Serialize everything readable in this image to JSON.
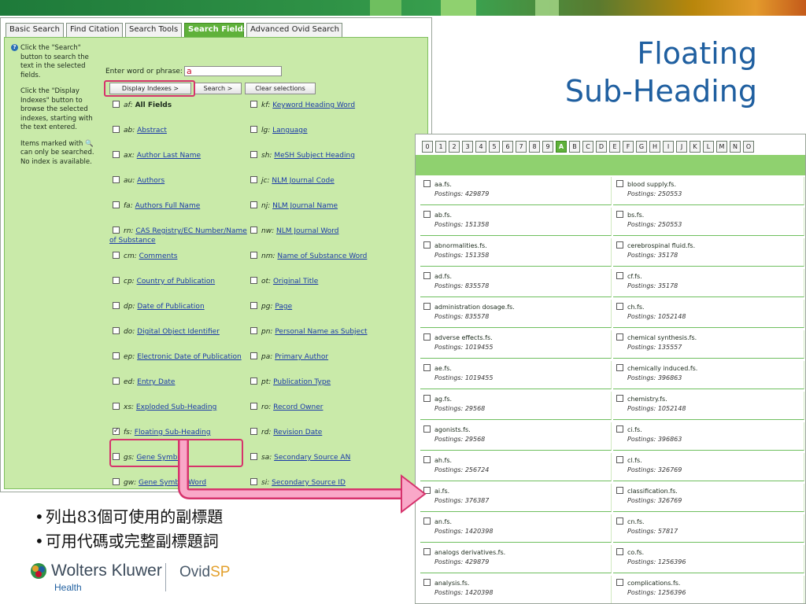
{
  "slide": {
    "title_line1": "Floating",
    "title_line2": "Sub-Heading",
    "bullets": [
      "列出83個可使用的副標題",
      "可用代碼或完整副標題詞"
    ],
    "title_color": "#1f5fa0",
    "accent_pink": "#d6336c"
  },
  "search_panel": {
    "tabs": [
      {
        "label": "Basic Search",
        "active": false
      },
      {
        "label": "Find Citation",
        "active": false
      },
      {
        "label": "Search Tools",
        "active": false
      },
      {
        "label": "Search Fields",
        "active": true
      },
      {
        "label": "Advanced Ovid Search",
        "active": false
      }
    ],
    "instructions": [
      "Click the \"Search\" button to search the text in the selected fields.",
      "Click the \"Display Indexes\" button to browse the selected indexes, starting with the text entered.",
      "Items marked with 🔍 can only be searched. No index is available."
    ],
    "search_label": "Enter word or phrase:",
    "search_value": "a",
    "buttons": {
      "display_indexes": "Display Indexes >",
      "search": "Search >",
      "clear": "Clear selections"
    },
    "fields": [
      {
        "code": "af",
        "name": "All Fields",
        "checked": false,
        "bold": true
      },
      {
        "code": "kf",
        "name": "Keyword Heading Word",
        "checked": false
      },
      {
        "code": "ab",
        "name": "Abstract",
        "checked": false
      },
      {
        "code": "lg",
        "name": "Language",
        "checked": false
      },
      {
        "code": "ax",
        "name": "Author Last Name",
        "checked": false
      },
      {
        "code": "sh",
        "name": "MeSH Subject Heading",
        "checked": false
      },
      {
        "code": "au",
        "name": "Authors",
        "checked": false
      },
      {
        "code": "jc",
        "name": "NLM Journal Code",
        "checked": false
      },
      {
        "code": "fa",
        "name": "Authors Full Name",
        "checked": false
      },
      {
        "code": "nj",
        "name": "NLM Journal Name",
        "checked": false
      },
      {
        "code": "rn",
        "name": "CAS Registry/EC Number/Name",
        "name2": "of Substance",
        "checked": false
      },
      {
        "code": "nw",
        "name": "NLM Journal Word",
        "checked": false
      },
      {
        "code": "cm",
        "name": "Comments",
        "checked": false
      },
      {
        "code": "nm",
        "name": "Name of Substance Word",
        "checked": false
      },
      {
        "code": "cp",
        "name": "Country of Publication",
        "checked": false
      },
      {
        "code": "ot",
        "name": "Original Title",
        "checked": false
      },
      {
        "code": "dp",
        "name": "Date of Publication",
        "checked": false
      },
      {
        "code": "pg",
        "name": "Page",
        "checked": false
      },
      {
        "code": "do",
        "name": "Digital Object Identifier",
        "checked": false
      },
      {
        "code": "pn",
        "name": "Personal Name as Subject",
        "checked": false
      },
      {
        "code": "ep",
        "name": "Electronic Date of Publication",
        "checked": false
      },
      {
        "code": "pa",
        "name": "Primary Author",
        "checked": false
      },
      {
        "code": "ed",
        "name": "Entry Date",
        "checked": false
      },
      {
        "code": "pt",
        "name": "Publication Type",
        "checked": false
      },
      {
        "code": "xs",
        "name": "Exploded Sub-Heading",
        "checked": false
      },
      {
        "code": "ro",
        "name": "Record Owner",
        "checked": false
      },
      {
        "code": "fs",
        "name": "Floating Sub-Heading",
        "checked": true
      },
      {
        "code": "rd",
        "name": "Revision Date",
        "checked": false
      },
      {
        "code": "gs",
        "name": "Gene Symbol",
        "checked": false
      },
      {
        "code": "sa",
        "name": "Secondary Source AN",
        "checked": false
      },
      {
        "code": "gw",
        "name": "Gene Symbol Word",
        "checked": false
      },
      {
        "code": "si",
        "name": "Secondary Source ID",
        "checked": false
      }
    ]
  },
  "index_panel": {
    "letters": [
      "0",
      "1",
      "2",
      "3",
      "4",
      "5",
      "6",
      "7",
      "8",
      "9",
      "A",
      "B",
      "C",
      "D",
      "E",
      "F",
      "G",
      "H",
      "I",
      "J",
      "K",
      "L",
      "M",
      "N",
      "O"
    ],
    "active_letter": "A",
    "postings_label": "Postings:",
    "left_column": [
      {
        "term": "aa.fs.",
        "postings": "429879"
      },
      {
        "term": "ab.fs.",
        "postings": "151358"
      },
      {
        "term": "abnormalities.fs.",
        "postings": "151358"
      },
      {
        "term": "ad.fs.",
        "postings": "835578"
      },
      {
        "term": "administration dosage.fs.",
        "postings": "835578"
      },
      {
        "term": "adverse effects.fs.",
        "postings": "1019455"
      },
      {
        "term": "ae.fs.",
        "postings": "1019455"
      },
      {
        "term": "ag.fs.",
        "postings": "29568"
      },
      {
        "term": "agonists.fs.",
        "postings": "29568"
      },
      {
        "term": "ah.fs.",
        "postings": "256724"
      },
      {
        "term": "ai.fs.",
        "postings": "376387"
      },
      {
        "term": "an.fs.",
        "postings": "1420398"
      },
      {
        "term": "analogs derivatives.fs.",
        "postings": "429879"
      },
      {
        "term": "analysis.fs.",
        "postings": "1420398"
      }
    ],
    "right_column": [
      {
        "term": "blood supply.fs.",
        "postings": "250553"
      },
      {
        "term": "bs.fs.",
        "postings": "250553"
      },
      {
        "term": "cerebrospinal fluid.fs.",
        "postings": "35178"
      },
      {
        "term": "cf.fs.",
        "postings": "35178"
      },
      {
        "term": "ch.fs.",
        "postings": "1052148"
      },
      {
        "term": "chemical synthesis.fs.",
        "postings": "135557"
      },
      {
        "term": "chemically induced.fs.",
        "postings": "396863"
      },
      {
        "term": "chemistry.fs.",
        "postings": "1052148"
      },
      {
        "term": "ci.fs.",
        "postings": "396863"
      },
      {
        "term": "cl.fs.",
        "postings": "326769"
      },
      {
        "term": "classification.fs.",
        "postings": "326769"
      },
      {
        "term": "cn.fs.",
        "postings": "57817"
      },
      {
        "term": "co.fs.",
        "postings": "1256396"
      },
      {
        "term": "complications.fs.",
        "postings": "1256396"
      }
    ]
  },
  "footer": {
    "company": "Wolters Kluwer",
    "division": "Health",
    "product_main": "Ovid",
    "product_suffix": "SP",
    "icon": "globe-icon"
  }
}
